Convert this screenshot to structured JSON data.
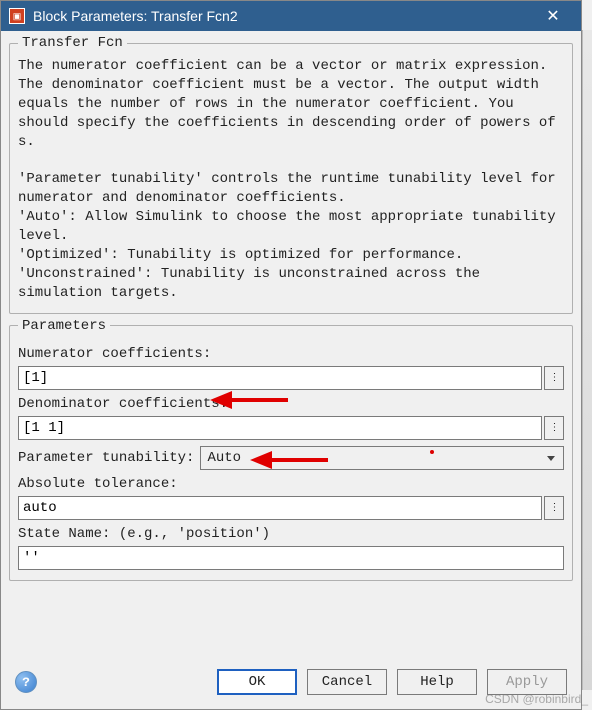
{
  "window": {
    "title": "Block Parameters: Transfer Fcn2"
  },
  "group1": {
    "legend": "Transfer Fcn",
    "description": "The numerator coefficient can be a vector or matrix expression. The denominator coefficient must be a vector. The output width equals the number of rows in the numerator coefficient. You should specify the coefficients in descending order of powers of s.\n\n'Parameter tunability' controls the runtime tunability level for numerator and denominator coefficients.\n'Auto': Allow Simulink to choose the most appropriate tunability level.\n'Optimized': Tunability is optimized for performance.\n'Unconstrained': Tunability is unconstrained across the simulation targets."
  },
  "group2": {
    "legend": "Parameters",
    "numerator_label": "Numerator coefficients:",
    "numerator_value": "[1]",
    "denominator_label": "Denominator coefficients:",
    "denominator_value": "[1 1]",
    "tunability_label": "Parameter tunability: ",
    "tunability_value": "Auto",
    "abstol_label": "Absolute tolerance:",
    "abstol_value": "auto",
    "statename_label": "State Name: (e.g., 'position')",
    "statename_value": "''"
  },
  "buttons": {
    "ok": "OK",
    "cancel": "Cancel",
    "help": "Help",
    "apply": "Apply"
  },
  "watermark": "CSDN @robinbird_"
}
